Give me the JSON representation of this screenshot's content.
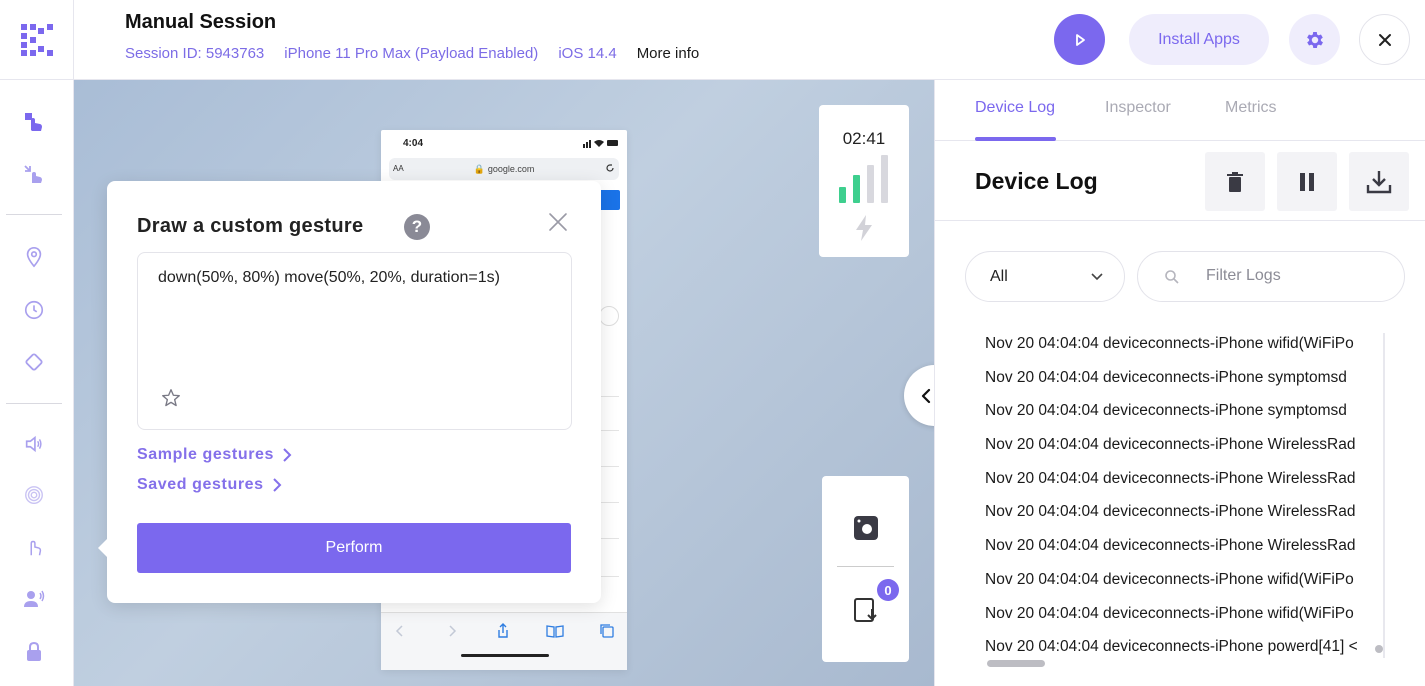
{
  "header": {
    "title": "Manual Session",
    "session_id": "Session ID: 5943763",
    "device": "iPhone 11 Pro Max (Payload Enabled)",
    "os": "iOS 14.4",
    "more_info": "More info",
    "install_apps": "Install Apps"
  },
  "sidebar": {
    "icons": [
      "gesture-icon",
      "tap-icon",
      "location-icon",
      "clock-icon",
      "rotate-icon",
      "volume-icon",
      "fingerprint-icon",
      "touch-icon",
      "voice-icon",
      "lock-icon"
    ]
  },
  "device": {
    "status_time": "4:04",
    "url_prefix": "AA",
    "url": "google.com",
    "timer": "02:41",
    "recording_count": "0"
  },
  "gesture_popup": {
    "title": "Draw a custom gesture",
    "help": "?",
    "gesture_text": "down(50%, 80%) move(50%, 20%, duration=1s)",
    "sample_gestures": "Sample gestures",
    "saved_gestures": "Saved gestures",
    "perform": "Perform"
  },
  "panel": {
    "tabs": [
      "Device Log",
      "Inspector",
      "Metrics"
    ],
    "active_tab": "Device Log",
    "title": "Device Log",
    "filter_select": "All",
    "filter_placeholder": "Filter Logs",
    "logs": [
      "Nov 20 04:04:04 deviceconnects-iPhone wifid(WiFiPo",
      "Nov 20 04:04:04 deviceconnects-iPhone symptomsd",
      "Nov 20 04:04:04 deviceconnects-iPhone symptomsd",
      "Nov 20 04:04:04 deviceconnects-iPhone WirelessRad",
      "Nov 20 04:04:04 deviceconnects-iPhone WirelessRad",
      "Nov 20 04:04:04 deviceconnects-iPhone WirelessRad",
      "Nov 20 04:04:04 deviceconnects-iPhone WirelessRad",
      "Nov 20 04:04:04 deviceconnects-iPhone wifid(WiFiPo",
      "Nov 20 04:04:04 deviceconnects-iPhone wifid(WiFiPo",
      "Nov 20 04:04:04 deviceconnects-iPhone powerd[41] <"
    ]
  },
  "colors": {
    "accent": "#7b68ee",
    "accent_light": "#efedfc",
    "signal_green": "#3ecf8e"
  }
}
